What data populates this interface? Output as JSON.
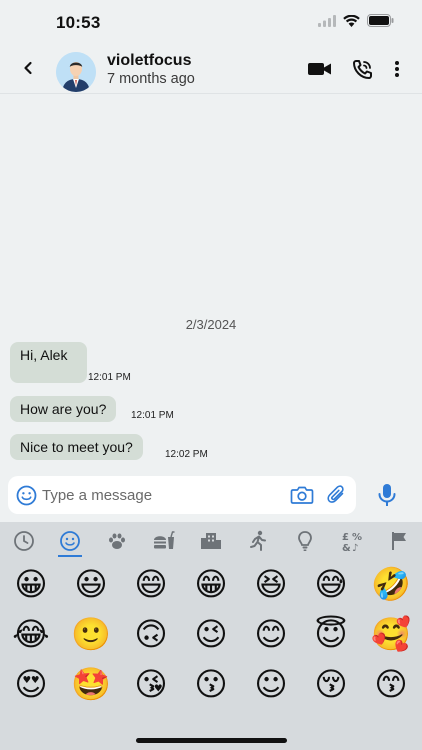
{
  "status_bar": {
    "time": "10:53"
  },
  "header": {
    "contact_name": "violetfocus",
    "last_seen": "7 months ago"
  },
  "chat": {
    "date_separator": "2/3/2024",
    "messages": [
      {
        "text": "Hi, Alek",
        "time": "12:01 PM"
      },
      {
        "text": "How are you?",
        "time": "12:01 PM"
      },
      {
        "text": "Nice to meet you?",
        "time": "12:02 PM"
      }
    ]
  },
  "composer": {
    "placeholder": "Type a message"
  },
  "emoji_keyboard": {
    "tabs": [
      "recent",
      "smileys",
      "animals",
      "food",
      "travel",
      "activity",
      "objects",
      "symbols",
      "flags"
    ],
    "selected_tab": "smileys",
    "emojis": [
      "😀",
      "😃",
      "😄",
      "😁",
      "😆",
      "😅",
      "🤣",
      "😂",
      "🙂",
      "🙃",
      "😉",
      "😊",
      "😇",
      "🥰",
      "😍",
      "🤩",
      "😘",
      "😗",
      "☺",
      "😚",
      "😙"
    ]
  },
  "colors": {
    "background": "#eef1f2",
    "bubble": "#d4ddd6",
    "accent": "#2f7bd6",
    "keyboard": "#d6dadd"
  }
}
